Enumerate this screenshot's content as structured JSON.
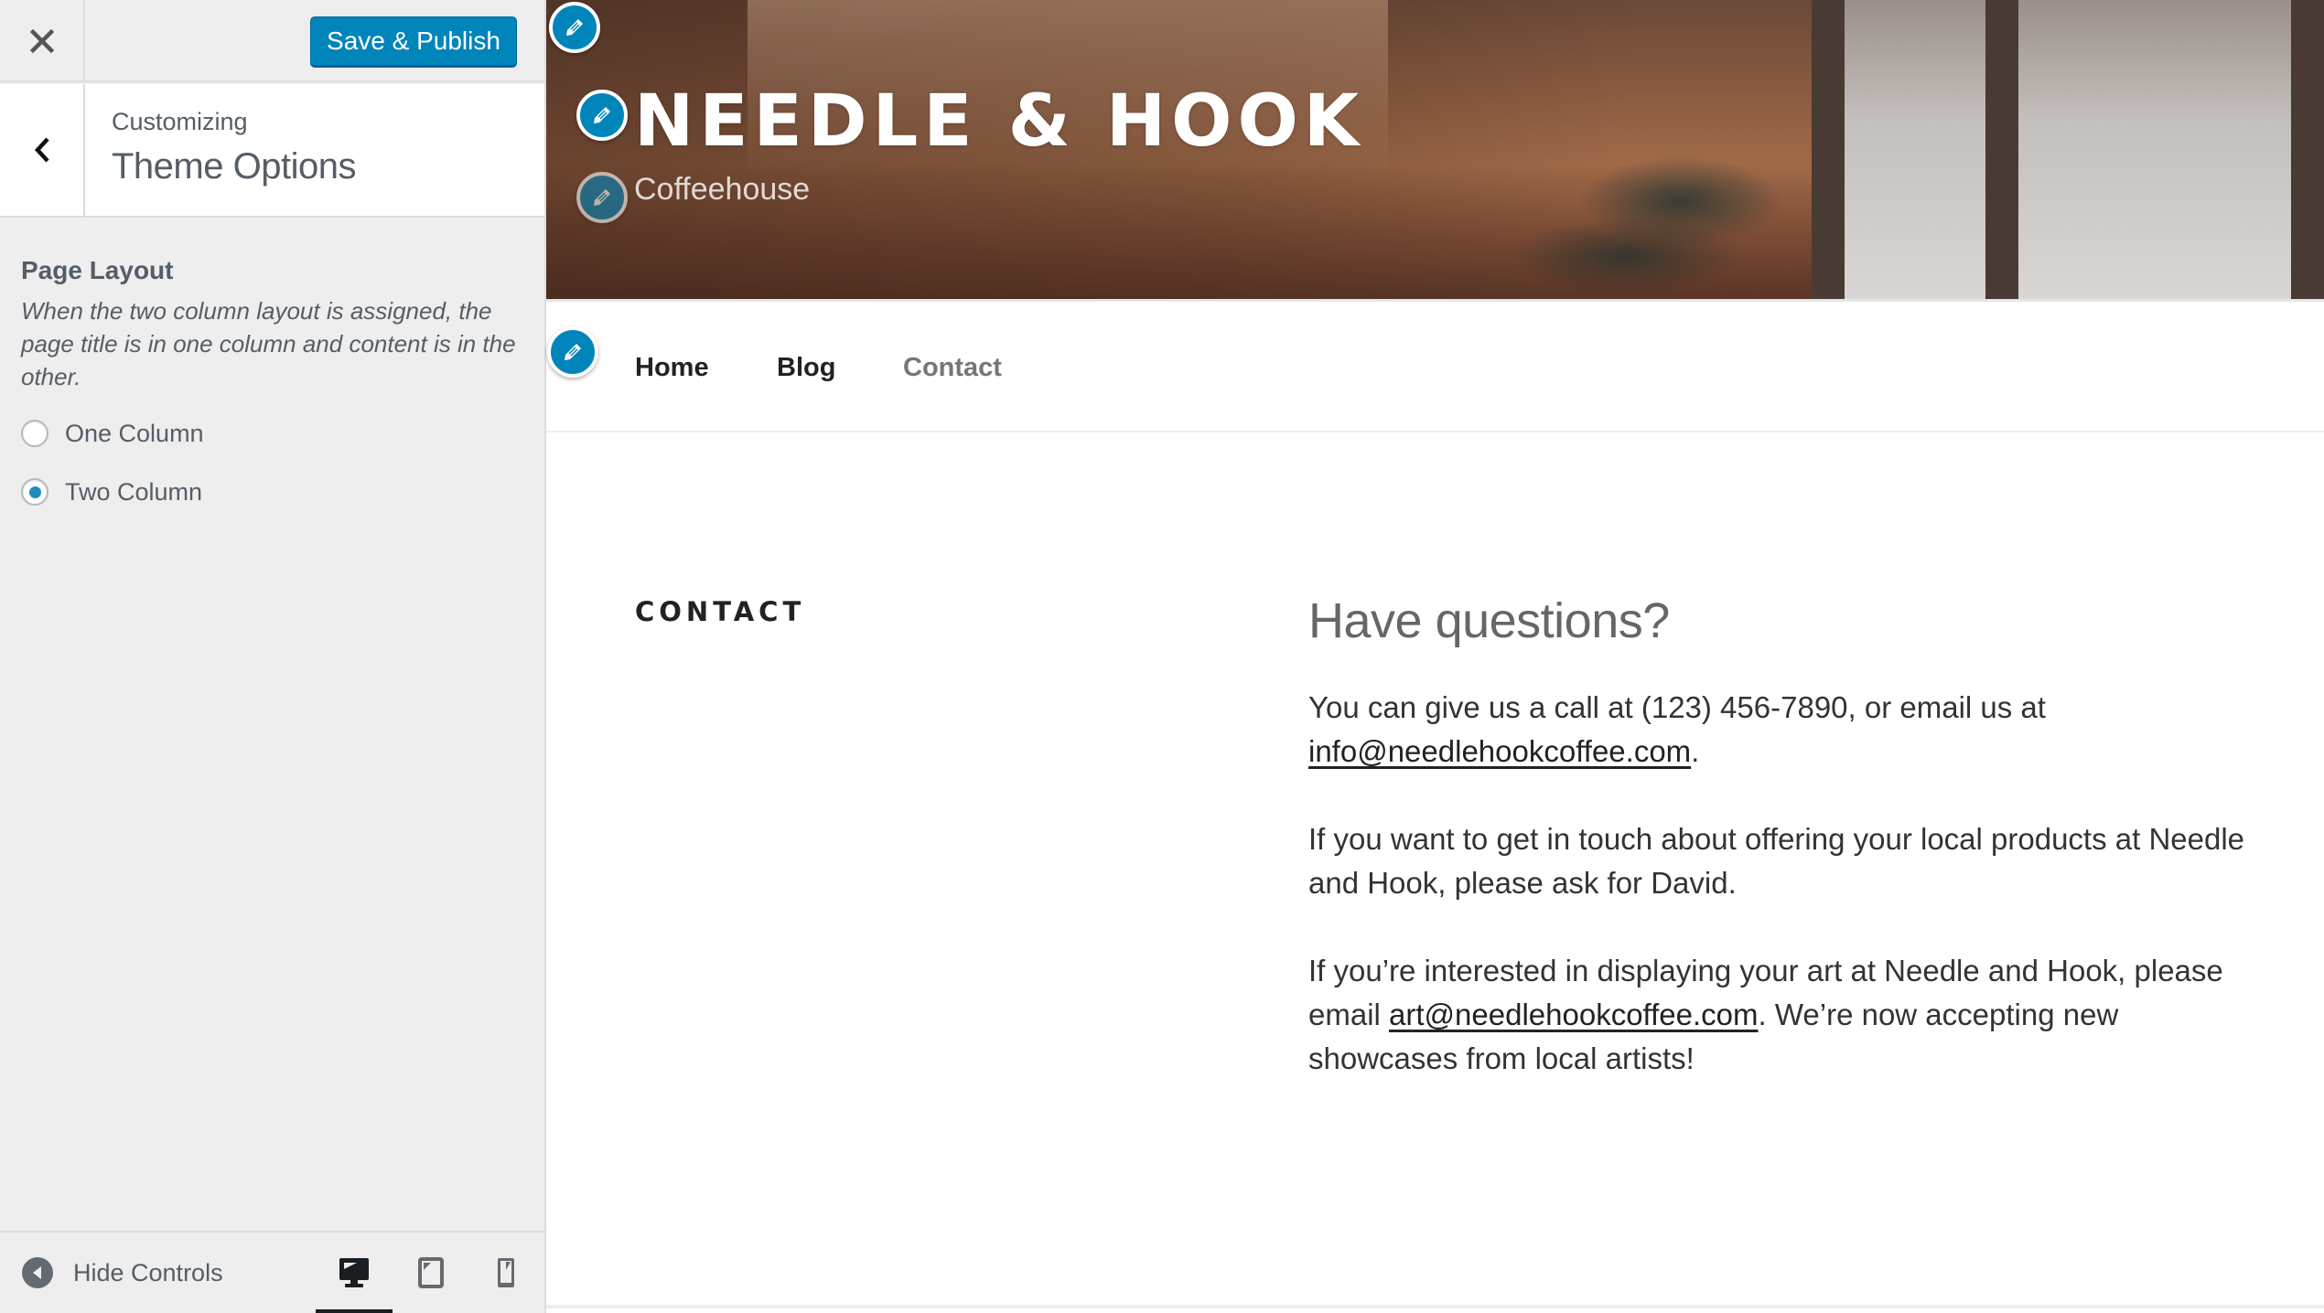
{
  "sidebar": {
    "save_button": "Save & Publish",
    "section": {
      "eyebrow": "Customizing",
      "title": "Theme Options"
    },
    "control": {
      "title": "Page Layout",
      "description": "When the two column layout is assigned, the page title is in one column and content is in the other.",
      "options": [
        {
          "label": "One Column",
          "checked": false
        },
        {
          "label": "Two Column",
          "checked": true
        }
      ]
    },
    "footer": {
      "hide_controls": "Hide Controls",
      "devices": [
        "desktop",
        "tablet",
        "mobile"
      ],
      "active_device": "desktop"
    },
    "accent_color": "#0085ba"
  },
  "preview": {
    "site_title": "NEEDLE & HOOK",
    "tagline": "Coffeehouse",
    "nav": [
      {
        "label": "Home",
        "current": false
      },
      {
        "label": "Blog",
        "current": false
      },
      {
        "label": "Contact",
        "current": true
      }
    ],
    "page_title": "CONTACT",
    "content": {
      "heading": "Have questions?",
      "p1_text": "You can give us a call at (123) 456-7890, or email us at ",
      "p1_link": "info@needlehookcoffee.com",
      "p1_end": ".",
      "p2": "If you want to get in touch about offering your local products at Needle and Hook, please ask for David.",
      "p3_text": "If you’re interested in displaying your art at Needle and Hook, please email ",
      "p3_link": "art@needlehookcoffee.com",
      "p3_end": ". We’re now accepting new showcases from local artists!"
    }
  }
}
